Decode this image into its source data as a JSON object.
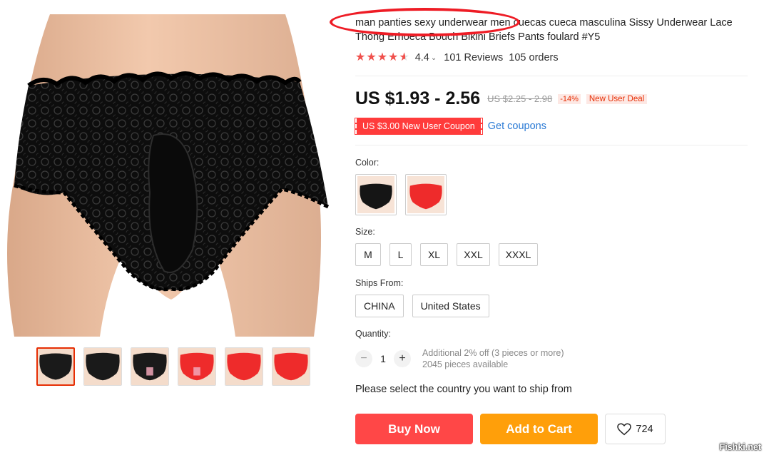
{
  "product": {
    "title": "man panties sexy underwear men cuecas cueca masculina Sissy Underwear Lace Thong Erhoeca Bouch Bikini Briefs Pants foulard #Y5"
  },
  "rating": {
    "stars": 4.4,
    "value_label": "4.4",
    "chevron": "⌄",
    "reviews": "101 Reviews",
    "orders": "105 orders",
    "star_color": "#f0504c"
  },
  "price": {
    "current": "US $1.93 - 2.56",
    "original": "US $2.25 - 2.98",
    "discount": "-14%",
    "deal": "New User Deal"
  },
  "coupon": {
    "badge": "US $3.00 New User Coupon",
    "link": "Get coupons"
  },
  "color": {
    "label": "Color:",
    "options": [
      {
        "name": "black",
        "swatch": "#1a1a1a"
      },
      {
        "name": "red",
        "swatch": "#ee2b2b"
      }
    ]
  },
  "size": {
    "label": "Size:",
    "options": [
      "M",
      "L",
      "XL",
      "XXL",
      "XXXL"
    ]
  },
  "ships_from": {
    "label": "Ships From:",
    "options": [
      "CHINA",
      "United States"
    ]
  },
  "quantity": {
    "label": "Quantity:",
    "minus": "−",
    "value": "1",
    "plus": "+",
    "discount_note": "Additional 2% off (3 pieces or more)",
    "available": "2045 pieces available"
  },
  "ship_note": "Please select the country you want to ship from",
  "actions": {
    "buy_now": "Buy Now",
    "add_to_cart": "Add to Cart",
    "wishlist_icon": "heart-icon",
    "wishlist_count": "724"
  },
  "gallery": {
    "thumbnails": [
      {
        "name": "black-front",
        "color": "#1a1a1a",
        "active": true
      },
      {
        "name": "black-back",
        "color": "#1a1a1a",
        "active": false
      },
      {
        "name": "black-censored",
        "color": "#1a1a1a",
        "active": false
      },
      {
        "name": "red-censored",
        "color": "#ee2b2b",
        "active": false
      },
      {
        "name": "red-back",
        "color": "#ee2b2b",
        "active": false
      },
      {
        "name": "red-front",
        "color": "#ee2b2b",
        "active": false
      }
    ]
  },
  "watermark": "Fishki.net",
  "colors": {
    "buy": "#ff4747",
    "cart": "#ff9f0a",
    "link": "#2a7ad5",
    "annotation": "#ee1c25"
  }
}
